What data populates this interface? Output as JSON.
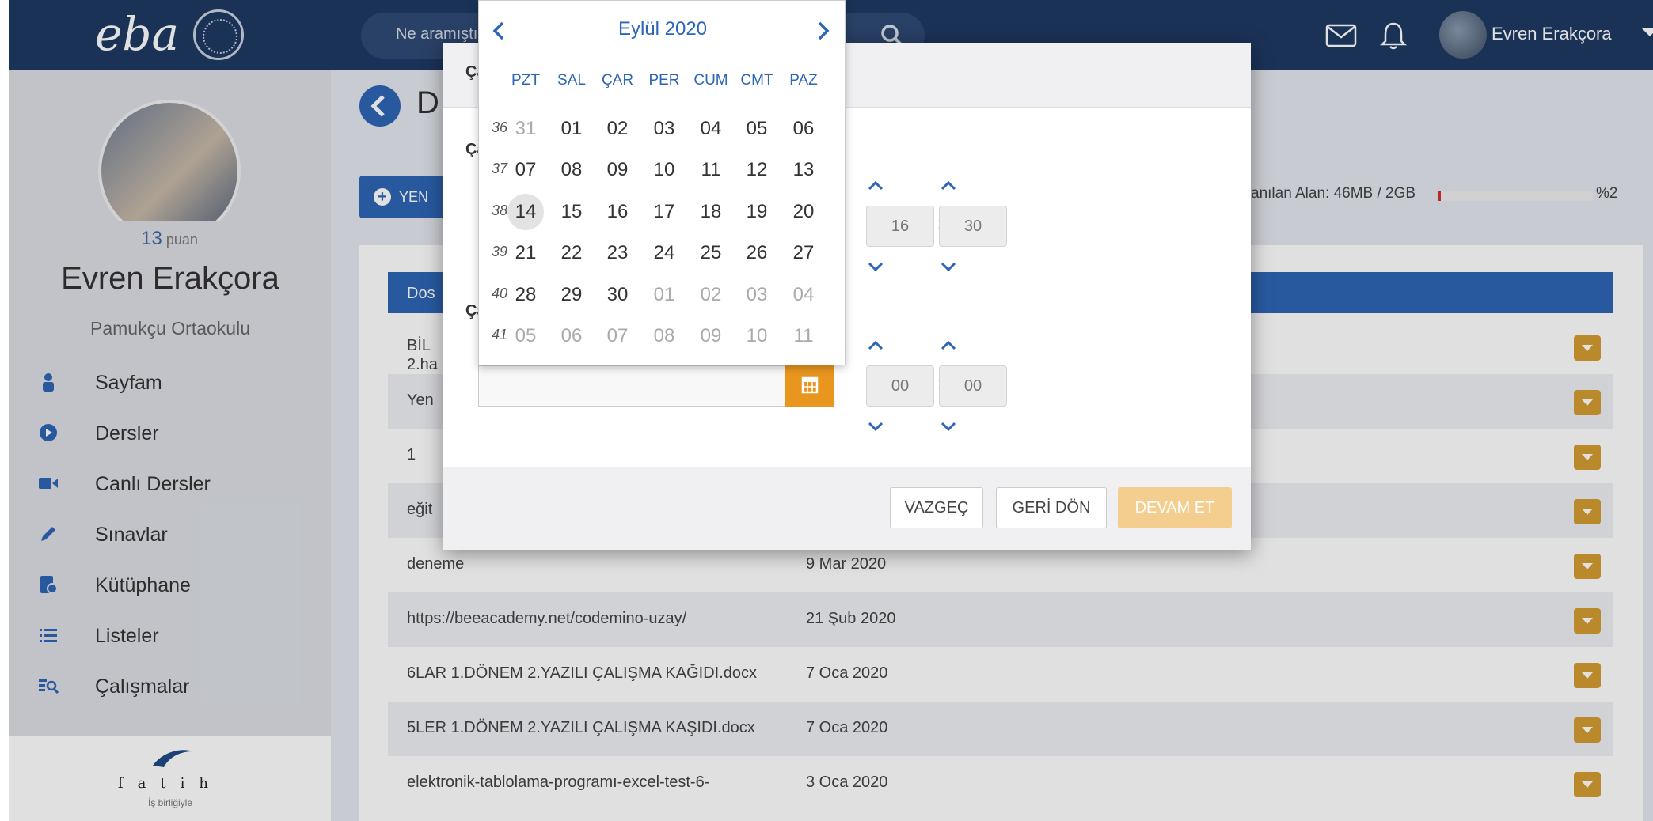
{
  "topbar": {
    "logo": "eba",
    "search_placeholder": "Ne aramıştınız?",
    "user_name": "Evren Erakçora"
  },
  "sidebar": {
    "points_value": "13",
    "points_label": "puan",
    "name": "Evren Erakçora",
    "school": "Pamukçu Ortaokulu",
    "items": [
      {
        "label": "Sayfam",
        "icon": "user-icon"
      },
      {
        "label": "Dersler",
        "icon": "play-circle-icon"
      },
      {
        "label": "Canlı Dersler",
        "icon": "video-camera-icon"
      },
      {
        "label": "Sınavlar",
        "icon": "pencil-icon"
      },
      {
        "label": "Kütüphane",
        "icon": "library-icon"
      },
      {
        "label": "Listeler",
        "icon": "list-icon"
      },
      {
        "label": "Çalışmalar",
        "icon": "search-list-icon"
      }
    ],
    "footer_brand": "fatih",
    "footer_sub": "İş birliğiyle"
  },
  "page": {
    "title_partial": "D",
    "new_button_partial": "YEN",
    "storage_label": "anılan Alan: 46MB / 2GB",
    "storage_percent_text": "%2",
    "storage_percent": 2,
    "table_header_partial": "Dos",
    "rows": [
      {
        "name": "BİL",
        "name2": "2.ha",
        "date": ""
      },
      {
        "name": "Yen",
        "name2": "",
        "date": ""
      },
      {
        "name": "1",
        "name2": "",
        "date": ""
      },
      {
        "name": "eğit",
        "name2": "",
        "date": ""
      },
      {
        "name": "deneme",
        "name2": "",
        "date": "9 Mar 2020"
      },
      {
        "name": "https://beeacademy.net/codemino-uzay/",
        "name2": "",
        "date": "21 Şub 2020"
      },
      {
        "name": "6LAR 1.DÖNEM 2.YAZILI ÇALIŞMA KAĞIDI.docx",
        "name2": "",
        "date": "7 Oca 2020"
      },
      {
        "name": "5LER 1.DÖNEM 2.YAZILI ÇALIŞMA KAŞIDI.docx",
        "name2": "",
        "date": "7 Oca 2020"
      },
      {
        "name": "elektronik-tablolama-programı-excel-test-6-",
        "name2": "",
        "date": "3 Oca 2020"
      }
    ]
  },
  "modal": {
    "header_partial": "Ça",
    "label1_partial": "Ça",
    "label2_partial": "Ça",
    "start_hour": "16",
    "start_minute": "30",
    "end_hour": "00",
    "end_minute": "00",
    "time_sep": ":",
    "cancel_label": "VAZGEÇ",
    "back_label": "GERİ DÖN",
    "continue_label": "DEVAM ET"
  },
  "calendar": {
    "month_title": "Eylül 2020",
    "weekdays": [
      "PZT",
      "SAL",
      "ÇAR",
      "PER",
      "CUM",
      "CMT",
      "PAZ"
    ],
    "weeks": [
      {
        "week": "36",
        "days": [
          "31",
          "01",
          "02",
          "03",
          "04",
          "05",
          "06"
        ]
      },
      {
        "week": "37",
        "days": [
          "07",
          "08",
          "09",
          "10",
          "11",
          "12",
          "13"
        ]
      },
      {
        "week": "38",
        "days": [
          "14",
          "15",
          "16",
          "17",
          "18",
          "19",
          "20"
        ]
      },
      {
        "week": "39",
        "days": [
          "21",
          "22",
          "23",
          "24",
          "25",
          "26",
          "27"
        ]
      },
      {
        "week": "40",
        "days": [
          "28",
          "29",
          "30",
          "01",
          "02",
          "03",
          "04"
        ]
      },
      {
        "week": "41",
        "days": [
          "05",
          "06",
          "07",
          "08",
          "09",
          "10",
          "11"
        ]
      }
    ],
    "today": "14"
  },
  "colors": {
    "brand_navy": "#1f3a63",
    "accent_blue": "#2e66b6",
    "accent_orange": "#e8961e",
    "dropdown_gold": "#d49c33"
  }
}
